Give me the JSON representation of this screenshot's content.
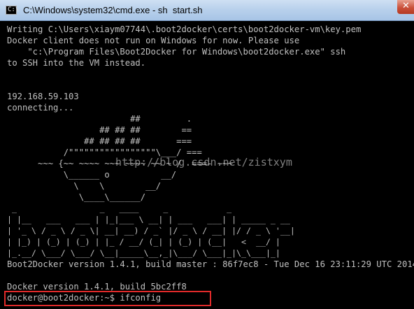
{
  "window": {
    "title": "C:\\Windows\\system32\\cmd.exe - sh  start.sh",
    "app_icon_text": "C:\\"
  },
  "console": {
    "lines": [
      "Writing C:\\Users\\xiaym07744\\.boot2docker\\certs\\boot2docker-vm\\key.pem",
      "Docker client does not run on Windows for now. Please use",
      "    \"c:\\Program Files\\Boot2Docker for Windows\\boot2docker.exe\" ssh",
      "to SSH into the VM instead.",
      "",
      "",
      "192.168.59.103",
      "connecting...",
      "                        ##         .",
      "                  ## ## ##        ==",
      "               ## ## ## ##       ===",
      "           /\"\"\"\"\"\"\"\"\"\"\"\"\"\"\"\"\"\\___/ ===",
      "      ~~~ {~~ ~~~~ ~~~ ~~~~ ~~ ~ /  ===- ~~~",
      "           \\______ o          __/",
      "             \\    \\        __/",
      "              \\____\\______/",
      " _                 _   ____     _            _",
      "| |__   ___   ___ | |_|___ \\ __| | ___   ___| | _____ _ __",
      "| '_ \\ / _ \\ / _ \\| __| __) / _` |/ _ \\ / __| |/ / _ \\ '__|",
      "| |_) | (_) | (_) | |_ / __/ (_| | (_) | (__|   <  __/ |",
      "|_.__/ \\___/ \\___/ \\__|_____\\__,_|\\___/ \\___|_|\\_\\___|_|",
      "Boot2Docker version 1.4.1, build master : 86f7ec8 - Tue Dec 16 23:11:29 UTC 2014",
      "",
      "Docker version 1.4.1, build 5bc2ff8",
      "docker@boot2docker:~$ ifconfig"
    ]
  },
  "watermark": "http://blog.csdn.net/zistxym",
  "colors": {
    "console_bg": "#000000",
    "console_fg": "#c0c0c0",
    "highlight_border": "#e12a2a",
    "titlebar": "#b9d1ec"
  },
  "icons": {
    "app": "cmd-prompt-icon",
    "close": "close-icon"
  }
}
